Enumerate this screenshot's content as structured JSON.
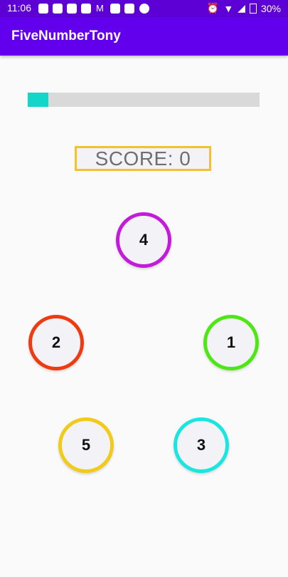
{
  "status_bar": {
    "time": "11:06",
    "battery_text": "30%",
    "icons": [
      "message-icon",
      "zalo-icon",
      "photo-icon",
      "photo-icon",
      "gmail-icon",
      "square-icon",
      "square-icon",
      "messenger-icon",
      "alarm-icon",
      "wifi-icon",
      "signal-icon",
      "battery-icon"
    ]
  },
  "app_bar": {
    "title": "FiveNumberTony",
    "color": "#6200ee"
  },
  "progress": {
    "value": 0.09,
    "color": "#14d6c8"
  },
  "score": {
    "text": "SCORE: 0",
    "border_color": "#f3c12e"
  },
  "circles": [
    {
      "number": "4",
      "color": "#c21bd9"
    },
    {
      "number": "2",
      "color": "#ef3b12"
    },
    {
      "number": "1",
      "color": "#4de814"
    },
    {
      "number": "5",
      "color": "#f2cb1a"
    },
    {
      "number": "3",
      "color": "#19e6e0"
    }
  ]
}
